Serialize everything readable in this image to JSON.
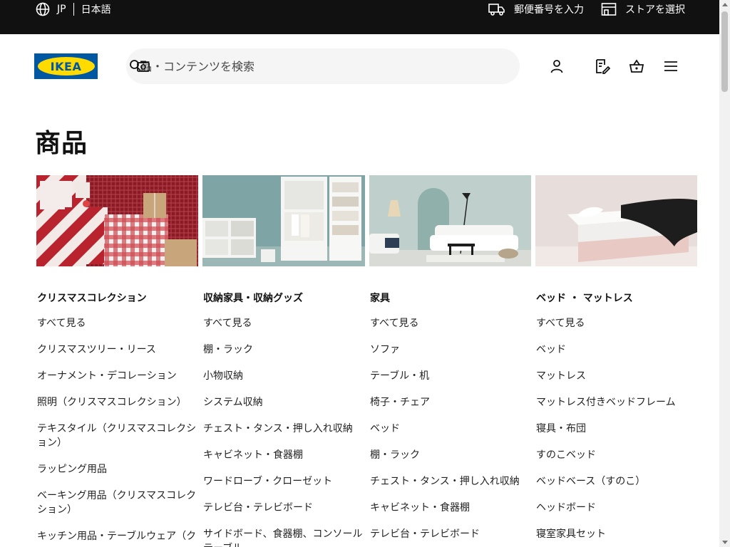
{
  "topbar": {
    "country": "JP",
    "language": "日本語",
    "postal_label": "郵便番号を入力",
    "store_label": "ストアを選択"
  },
  "header": {
    "logo_text": "IKEA",
    "search_placeholder": "品・コンテンツを検索"
  },
  "page": {
    "title": "商品"
  },
  "columns": [
    {
      "heading": "クリスマスコレクション",
      "items": [
        "すべて見る",
        "クリスマスツリー・リース",
        "オーナメント・デコレーション",
        "照明（クリスマスコレクション）",
        "テキスタイル（クリスマスコレクション）",
        "ラッピング用品",
        "ベーキング用品（クリスマスコレクション）",
        "キッチン用品・テーブルウェア（ク"
      ]
    },
    {
      "heading": "収納家具・収納グッズ",
      "items": [
        "すべて見る",
        "棚・ラック",
        "小物収納",
        "システム収納",
        "チェスト・タンス・押し入れ収納",
        "キャビネット・食器棚",
        "ワードローブ・クローゼット",
        "テレビ台・テレビボード",
        "サイドボード、食器棚、コンソール テーブル"
      ]
    },
    {
      "heading": "家具",
      "items": [
        "すべて見る",
        "ソファ",
        "テーブル・机",
        "椅子・チェア",
        "ベッド",
        "棚・ラック",
        "チェスト・タンス・押し入れ収納",
        "キャビネット・食器棚",
        "テレビ台・テレビボード"
      ]
    },
    {
      "heading": "ベッド ・ マットレス",
      "items": [
        "すべて見る",
        "ベッド",
        "マットレス",
        "マットレス付きベッドフレーム",
        "寝具・布団",
        "すのこベッド",
        "ベッドベース（すのこ）",
        "ヘッドボード",
        "寝室家具セット"
      ]
    }
  ]
}
